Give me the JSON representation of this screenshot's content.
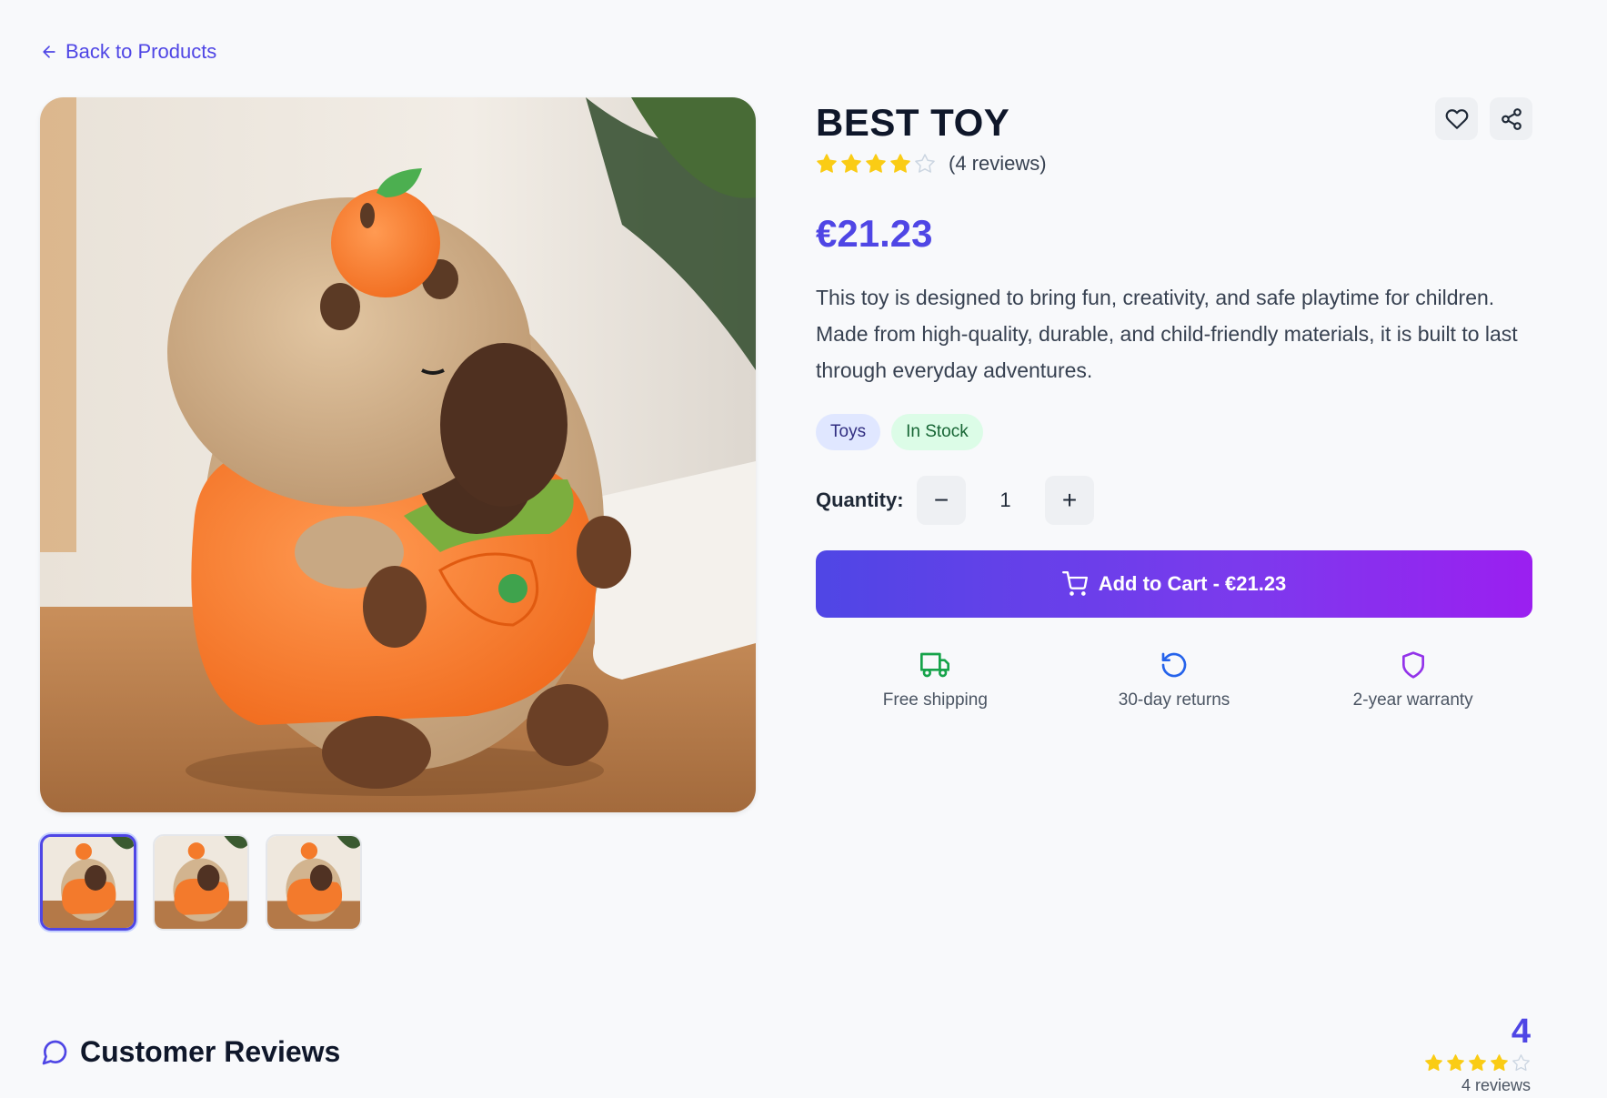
{
  "nav": {
    "back_label": "Back to Products"
  },
  "product": {
    "title": "BEST TOY",
    "rating": 4,
    "max_rating": 5,
    "reviews_text": "(4 reviews)",
    "price": "€21.23",
    "description": "This toy is designed to bring fun, creativity, and safe playtime for children. Made from high-quality, durable, and child-friendly materials, it is built to last through everyday adventures.",
    "category_badge": "Toys",
    "stock_badge": "In Stock"
  },
  "quantity": {
    "label": "Quantity:",
    "value": "1",
    "decrement": "−",
    "increment": "+"
  },
  "cart": {
    "label": "Add to Cart - €21.23"
  },
  "features": [
    {
      "label": "Free shipping",
      "icon": "truck-icon",
      "color": "#16a34a"
    },
    {
      "label": "30-day returns",
      "icon": "rotate-ccw-icon",
      "color": "#2563eb"
    },
    {
      "label": "2-year warranty",
      "icon": "shield-icon",
      "color": "#9333ea"
    }
  ],
  "reviews": {
    "title": "Customer Reviews",
    "average": "4",
    "count_text": "4 reviews"
  },
  "colors": {
    "accent": "#4f46e5",
    "star": "#facc15",
    "star_empty": "#cbd5e1"
  }
}
